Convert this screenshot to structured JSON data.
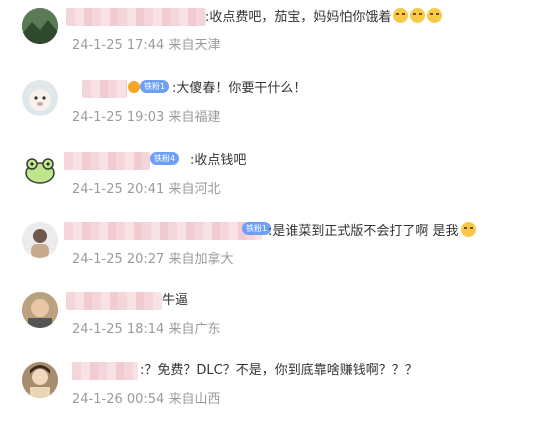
{
  "comments": [
    {
      "text": ":收点费吧，茄宝，妈妈怕你饿着",
      "emojis": 3,
      "time": "24-1-25 17:44",
      "location": "来自天津",
      "avatar_icon": "landscape-avatar"
    },
    {
      "badge": "铁粉1",
      "text": ":大傻春！你要干什么！",
      "time": "24-1-25 19:03",
      "location": "来自福建",
      "avatar_icon": "alpaca-avatar"
    },
    {
      "badge": "铁粉4",
      "text": ":收点钱吧",
      "time": "24-1-25 20:41",
      "location": "来自河北",
      "avatar_icon": "frog-avatar"
    },
    {
      "badge": "铁粉1",
      "text": ":是谁菜到正式版不会打了啊 是我",
      "emojis": 1,
      "time": "24-1-25 20:27",
      "location": "来自加拿大",
      "avatar_icon": "person-avatar"
    },
    {
      "text": "牛逼",
      "time": "24-1-25 18:14",
      "location": "来自广东",
      "avatar_icon": "face-avatar"
    },
    {
      "text": ":？免费？DLC？不是，你到底靠啥赚钱啊？？？",
      "time": "24-1-26 00:54",
      "location": "来自山西",
      "avatar_icon": "cartoon-avatar"
    }
  ]
}
